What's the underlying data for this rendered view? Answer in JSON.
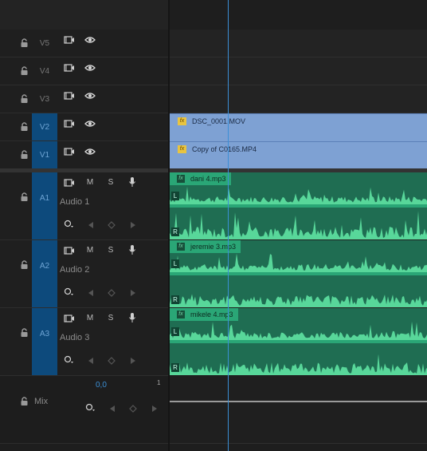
{
  "video_tracks": [
    {
      "id": "V5",
      "label": "V5",
      "targeted": false,
      "clip": null
    },
    {
      "id": "V4",
      "label": "V4",
      "targeted": false,
      "clip": null
    },
    {
      "id": "V3",
      "label": "V3",
      "targeted": false,
      "clip": null
    },
    {
      "id": "V2",
      "label": "V2",
      "targeted": true,
      "clip": {
        "fx": "fx",
        "name": "DSC_0001.MOV"
      }
    },
    {
      "id": "V1",
      "label": "V1",
      "targeted": true,
      "clip": {
        "fx": "fx",
        "name": "Copy of C0165.MP4"
      }
    }
  ],
  "audio_tracks": [
    {
      "id": "A1",
      "label": "A1",
      "name": "Audio 1",
      "mute": "M",
      "solo": "S",
      "clip": {
        "fx": "fx",
        "name": "dani 4.mp3"
      },
      "channels": [
        "L",
        "R"
      ]
    },
    {
      "id": "A2",
      "label": "A2",
      "name": "Audio 2",
      "mute": "M",
      "solo": "S",
      "clip": {
        "fx": "fx",
        "name": "jeremie 3.mp3"
      },
      "channels": [
        "L",
        "R"
      ]
    },
    {
      "id": "A3",
      "label": "A3",
      "name": "Audio 3",
      "mute": "M",
      "solo": "S",
      "clip": {
        "fx": "fx",
        "name": "mikele 4.mp3"
      },
      "channels": [
        "L",
        "R"
      ]
    }
  ],
  "mix": {
    "label": "Mix",
    "value": "0,0",
    "corner": "1"
  },
  "colors": {
    "accent": "#0d4a7c",
    "video_clip": "#7ea1d3",
    "audio_clip": "#1f6d52",
    "playhead": "#3b8fd6"
  },
  "icons": [
    "lock-icon",
    "film-icon",
    "eye-icon",
    "mic-icon",
    "keyframe-icon",
    "prev-keyframe-icon",
    "add-keyframe-icon",
    "next-keyframe-icon"
  ]
}
